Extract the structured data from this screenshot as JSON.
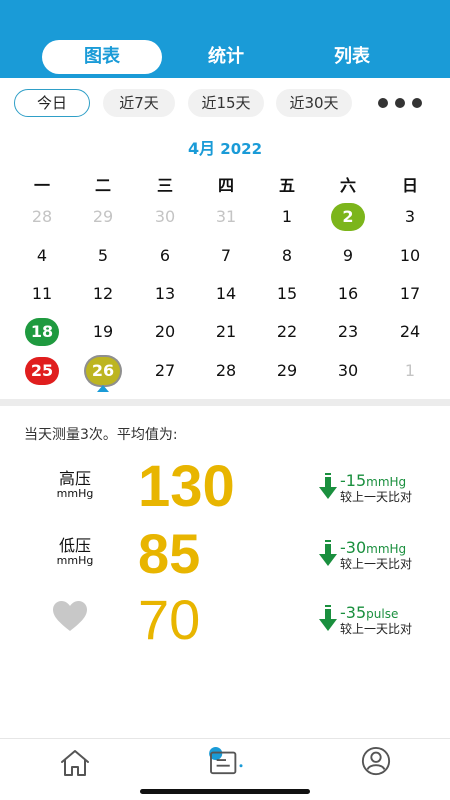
{
  "tabs": [
    {
      "label": "图表",
      "active": true
    },
    {
      "label": "统计",
      "active": false
    },
    {
      "label": "列表",
      "active": false
    }
  ],
  "ranges": [
    {
      "label": "今日",
      "active": true
    },
    {
      "label": "近7天",
      "active": false
    },
    {
      "label": "近15天",
      "active": false
    },
    {
      "label": "近30天",
      "active": false
    }
  ],
  "more_icon": "more-dots-icon",
  "calendar": {
    "month_label": "4月",
    "year_label": " 2022",
    "weekdays": [
      "一",
      "二",
      "三",
      "四",
      "五",
      "六",
      "日"
    ],
    "weeks": [
      [
        "28",
        "29",
        "30",
        "31",
        "1",
        "2",
        "3"
      ],
      [
        "4",
        "5",
        "6",
        "7",
        "8",
        "9",
        "10"
      ],
      [
        "11",
        "12",
        "13",
        "14",
        "15",
        "16",
        "17"
      ],
      [
        "18",
        "19",
        "20",
        "21",
        "22",
        "23",
        "24"
      ],
      [
        "25",
        "26",
        "27",
        "28",
        "29",
        "30",
        "1"
      ]
    ],
    "muted": [
      [
        0,
        0
      ],
      [
        0,
        1
      ],
      [
        0,
        2
      ],
      [
        0,
        3
      ],
      [
        4,
        6
      ]
    ],
    "marked": [
      {
        "week": 0,
        "day": 5,
        "color": "#7cb51b"
      },
      {
        "week": 3,
        "day": 0,
        "color": "#1f9a3f"
      },
      {
        "week": 4,
        "day": 0,
        "color": "#e01e1e"
      },
      {
        "week": 4,
        "day": 1,
        "color": "#bdb521",
        "selected": true
      }
    ]
  },
  "summary": "当天测量3次。平均值为:",
  "readings": [
    {
      "label": "高压",
      "unit": "mmHg",
      "value": "130",
      "delta": "-15",
      "delta_unit": "mmHg",
      "compare": "较上一天比对"
    },
    {
      "label": "低压",
      "unit": "mmHg",
      "value": "85",
      "delta": "-30",
      "delta_unit": "mmHg",
      "compare": "较上一天比对"
    },
    {
      "label": "",
      "icon": "heart-icon",
      "value": "70",
      "delta": "-35",
      "delta_unit": "pulse",
      "compare": "较上一天比对"
    }
  ],
  "colors": {
    "primary": "#1a9bd7",
    "value": "#e8b500",
    "trend_down": "#1a8f3e"
  },
  "nav": [
    {
      "icon": "home-icon",
      "active": false
    },
    {
      "icon": "chart-report-icon",
      "active": true
    },
    {
      "icon": "profile-icon",
      "active": false
    }
  ]
}
